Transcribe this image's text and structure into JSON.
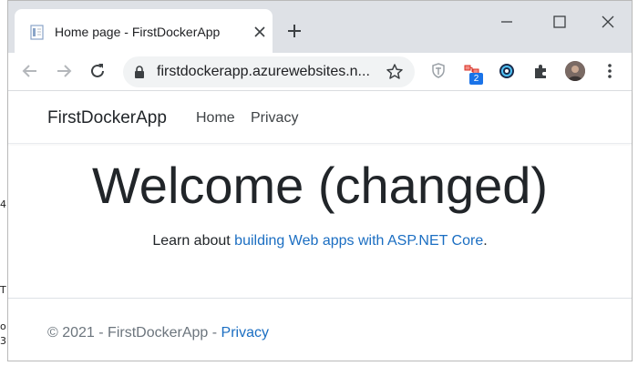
{
  "browser": {
    "tab_title": "Home page - FirstDockerApp",
    "url": "firstdockerapp.azurewebsites.n...",
    "extension_badge": "2"
  },
  "site": {
    "brand": "FirstDockerApp",
    "nav": [
      "Home",
      "Privacy"
    ],
    "hero_title": "Welcome (changed)",
    "hero_text_prefix": "Learn about ",
    "hero_link": "building Web apps with ASP.NET Core",
    "hero_text_suffix": ".",
    "footer_prefix": "© 2021 - FirstDockerApp - ",
    "footer_link": "Privacy"
  },
  "edge_glyphs": [
    "4",
    "T",
    "o",
    "3"
  ],
  "colors": {
    "link": "#1b6ec2",
    "tabstrip": "#dee1e6",
    "text": "#212529",
    "muted": "#6c757d"
  }
}
